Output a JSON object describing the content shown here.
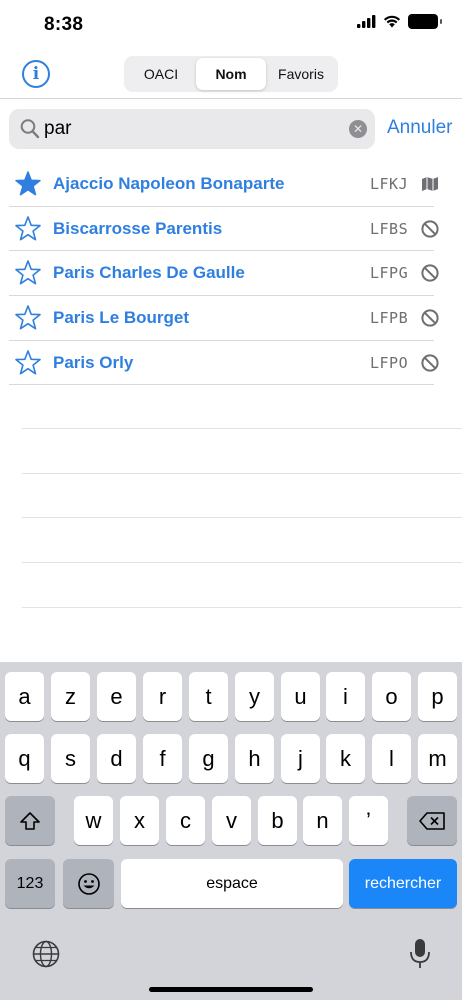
{
  "status_bar": {
    "time": "8:38"
  },
  "header": {
    "info_icon": "info-circle-icon",
    "segments": [
      {
        "label": "OACI",
        "active": false
      },
      {
        "label": "Nom",
        "active": true
      },
      {
        "label": "Favoris",
        "active": false
      }
    ]
  },
  "search": {
    "value": "par",
    "cancel_label": "Annuler"
  },
  "airports": [
    {
      "name": "Ajaccio Napoleon Bonaparte",
      "code": "LFKJ",
      "favorite": true,
      "status_icon": "map-icon"
    },
    {
      "name": "Biscarrosse Parentis",
      "code": "LFBS",
      "favorite": false,
      "status_icon": "prohibited-icon"
    },
    {
      "name": "Paris Charles De Gaulle",
      "code": "LFPG",
      "favorite": false,
      "status_icon": "prohibited-icon"
    },
    {
      "name": "Paris Le Bourget",
      "code": "LFPB",
      "favorite": false,
      "status_icon": "prohibited-icon"
    },
    {
      "name": "Paris Orly",
      "code": "LFPO",
      "favorite": false,
      "status_icon": "prohibited-icon"
    }
  ],
  "keyboard": {
    "row1": [
      "a",
      "z",
      "e",
      "r",
      "t",
      "y",
      "u",
      "i",
      "o",
      "p"
    ],
    "row2": [
      "q",
      "s",
      "d",
      "f",
      "g",
      "h",
      "j",
      "k",
      "l",
      "m"
    ],
    "row3": [
      "w",
      "x",
      "c",
      "v",
      "b",
      "n",
      "’"
    ],
    "numbers_label": "123",
    "space_label": "espace",
    "return_label": "rechercher"
  },
  "colors": {
    "accent": "#2f7fe0",
    "return_key": "#1a86f7",
    "keyboard_bg": "#d2d4da"
  }
}
